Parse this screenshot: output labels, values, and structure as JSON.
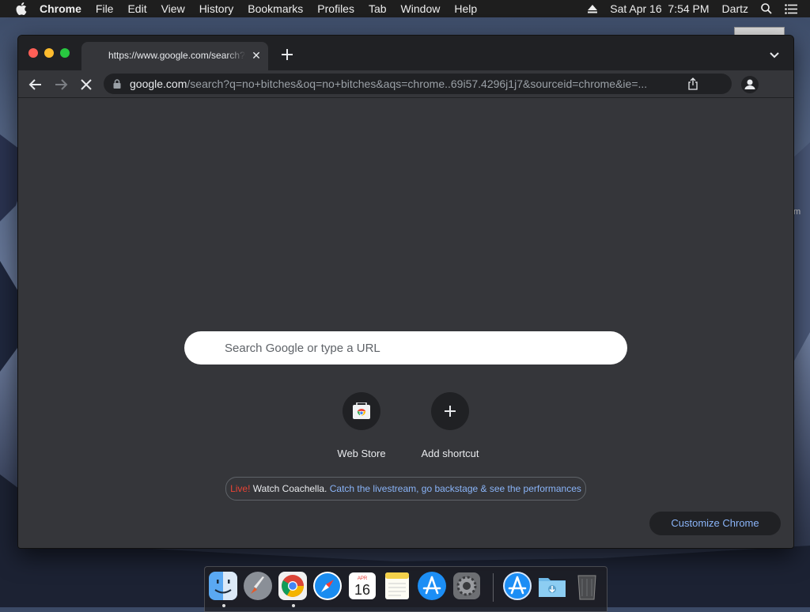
{
  "menubar": {
    "app_name": "Chrome",
    "items": [
      "File",
      "Edit",
      "View",
      "History",
      "Bookmarks",
      "Profiles",
      "Tab",
      "Window",
      "Help"
    ],
    "datetime": "Sat Apr 16  7:54 PM",
    "user": "Dartz"
  },
  "desktop": {
    "side_text": "m"
  },
  "tab": {
    "title": "https://www.google.com/search?q=no+bitches"
  },
  "omnibox": {
    "host": "google.com",
    "path": "/search?q=no+bitches&oq=no+bitches&aqs=chrome..69i57.4296j1j7&sourceid=chrome&ie=..."
  },
  "ntp": {
    "search_placeholder": "Search Google or type a URL",
    "shortcuts": [
      {
        "label": "Web Store",
        "icon": "web-store-icon"
      },
      {
        "label": "Add shortcut",
        "icon": "plus-icon"
      }
    ],
    "promo": {
      "live": "Live!",
      "bold": "Watch Coachella.",
      "link": "Catch the livestream, go backstage & see the performances"
    },
    "customize_label": "Customize Chrome"
  },
  "dock": {
    "apps": [
      "Finder",
      "Launchpad",
      "Google Chrome",
      "Safari",
      "Calendar",
      "Notes",
      "App Store",
      "System Preferences",
      "App Store",
      "Downloads",
      "Trash"
    ],
    "calendar_month": "APR",
    "calendar_day": "16"
  },
  "colors": {
    "window_bg": "#35363a",
    "tabstrip_bg": "#202124",
    "link": "#8ab4f8",
    "live": "#ea4335"
  }
}
